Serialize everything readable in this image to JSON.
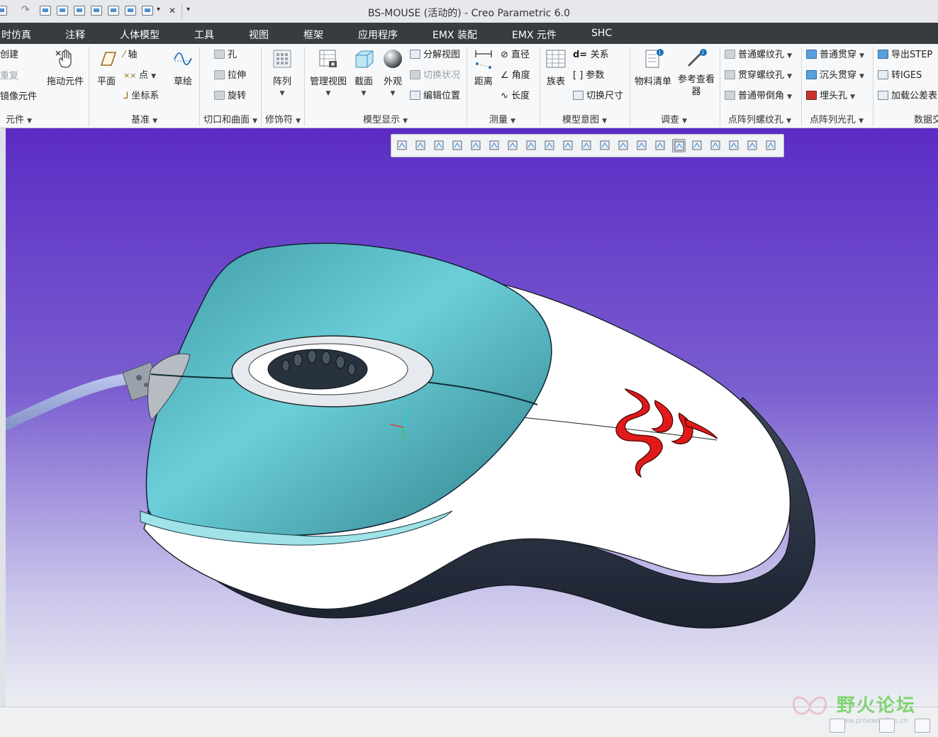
{
  "window": {
    "title": "BS-MOUSE (活动的) - Creo Parametric 6.0"
  },
  "menu": [
    "时仿真",
    "注释",
    "人体模型",
    "工具",
    "视图",
    "框架",
    "应用程序",
    "EMX 装配",
    "EMX 元件",
    "SHC"
  ],
  "ribbon": {
    "component_group": {
      "items": [
        "创建",
        "重复",
        "镜像元件"
      ],
      "drag_label": "拖动元件",
      "label": "元件"
    },
    "datum_group": {
      "plane": "平面",
      "axis": "轴",
      "point": "点",
      "csys": "坐标系",
      "sketch": "草绘",
      "label": "基准"
    },
    "cut_surface_group": {
      "hole": "孔",
      "extrude": "拉伸",
      "revolve": "旋转",
      "label": "切口和曲面"
    },
    "modifier_group": {
      "pattern": "阵列",
      "label": "修饰符"
    },
    "model_display_group": {
      "manage_views": "管理视图",
      "section": "截面",
      "appearance": "外观",
      "exploded": "分解视图",
      "toggle_status": "切换状况",
      "edit_position": "编辑位置",
      "label": "模型显示"
    },
    "measure_group": {
      "distance": "距离",
      "diameter": "直径",
      "angle": "角度",
      "length": "长度",
      "label": "测量"
    },
    "model_intent_group": {
      "family_table": "族表",
      "relations": "关系",
      "parameters": "参数",
      "switch_dims": "切换尺寸",
      "label": "模型意图"
    },
    "investigate_group": {
      "bom": "物料清单",
      "ref_viewer": "参考查看器",
      "label": "调查"
    },
    "point_pattern_thread": {
      "items": [
        "普通螺纹孔",
        "贯穿螺纹孔",
        "普通带倒角"
      ],
      "label": "点阵列螺纹孔"
    },
    "point_pattern_light": {
      "items": [
        "普通贯穿",
        "沉头贯穿",
        "埋头孔"
      ],
      "label": "点阵列光孔"
    },
    "data_exchange": {
      "items": [
        "导出STEP",
        "转IGES",
        "加载公差表"
      ],
      "label": "数据交"
    }
  },
  "view_toolbar": {
    "buttons": [
      "refit-icon",
      "zoom-in-icon",
      "zoom-out-icon",
      "repaint-icon",
      "orient-icon",
      "saved-views-icon",
      "display-style-icon",
      "section-icon",
      "appearance-icon",
      "perspective-icon",
      "named-views-icon",
      "plane-display-icon",
      "axis-display-icon",
      "point-display-icon",
      "csys-display-icon",
      "annotation-display-icon",
      "spin-center-icon",
      "view-manager-icon",
      "tag-display-icon",
      "show-all-icon",
      "fade-icon"
    ],
    "active_index": 15
  },
  "graphics": {
    "model": "mouse-model",
    "logo": "razer-logo"
  },
  "status": {
    "watermark": "野火论坛",
    "watermark_sub": "www.proewildfire.cn"
  },
  "colors": {
    "menubar": "#373c41",
    "bg_top": "#5b2cc4",
    "bg_bottom": "#eceef3",
    "teal": "#5ec4cf",
    "logo": "#e01a1a"
  }
}
